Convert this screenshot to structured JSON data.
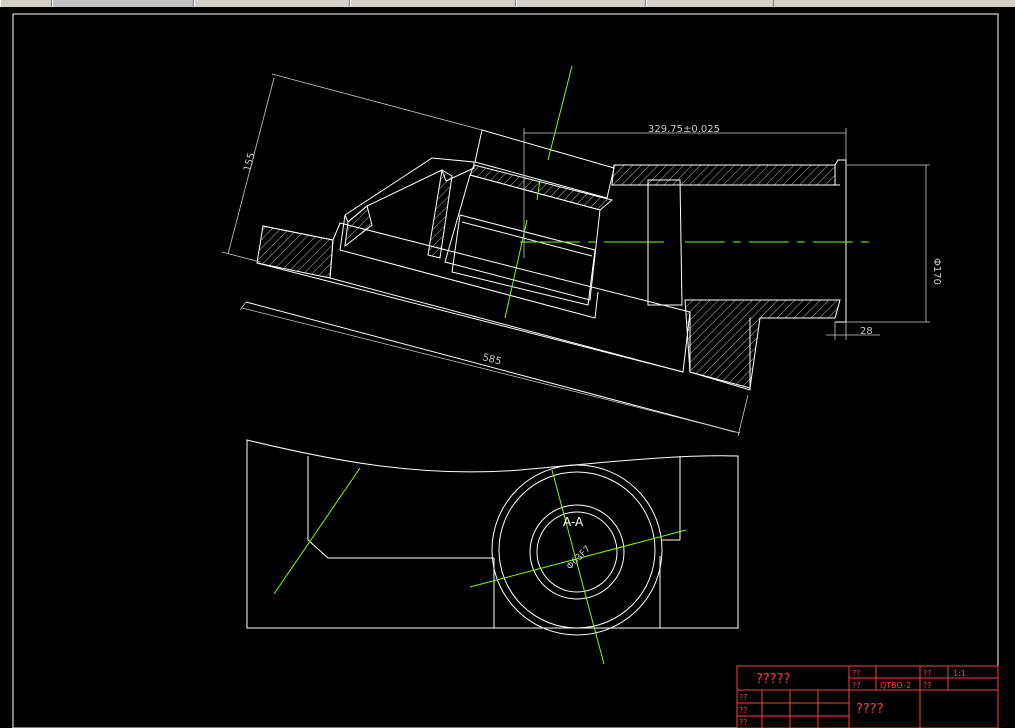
{
  "window": {
    "tabs": [
      "",
      "",
      "",
      "",
      "",
      ""
    ]
  },
  "drawing": {
    "dimensions": {
      "center_distance": "329.75±0.025",
      "height": "155",
      "length": "585",
      "diameter": "Φ170",
      "flange": "28",
      "bore": "Φ63F7"
    },
    "section_label": "A-A"
  },
  "title_block": {
    "name": "?????",
    "org": "????",
    "drawing_no": "QTBO-2",
    "scale": "1:1",
    "label_short": "??",
    "colors": {
      "frame": "#ff3c3c"
    }
  },
  "colors": {
    "lines": "#ffffff",
    "centerlines": "#7cfc00",
    "dimensions": "#c8c8c8",
    "frame": "#ffffff"
  }
}
